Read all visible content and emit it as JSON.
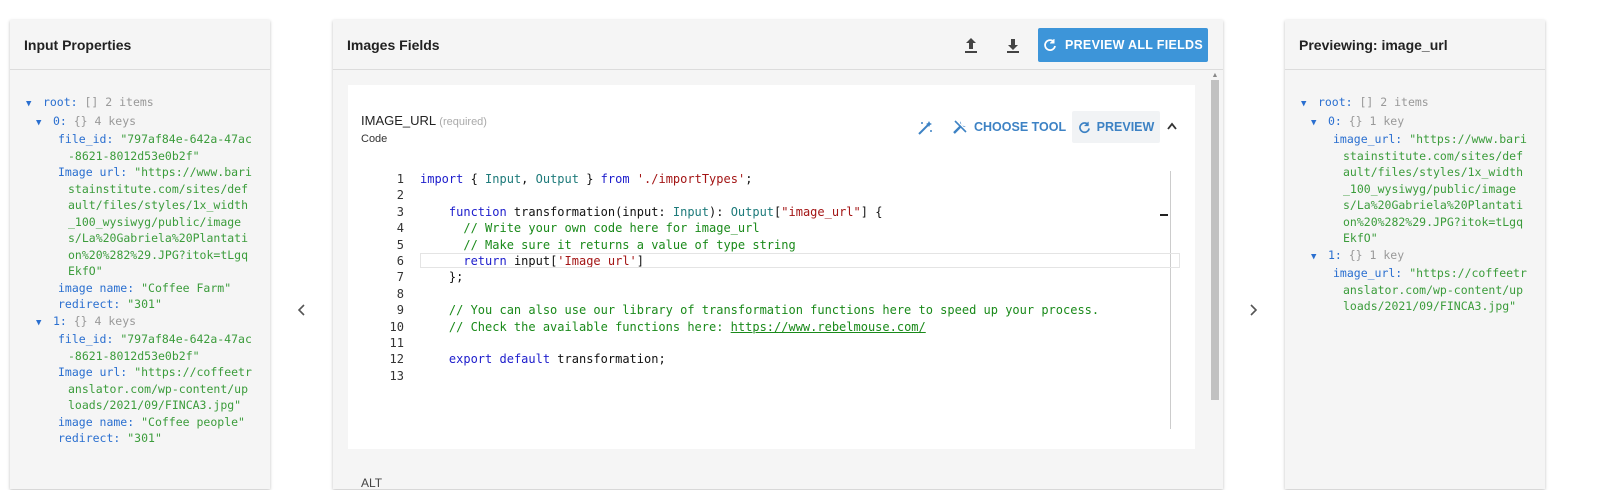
{
  "left_panel": {
    "title": "Input Properties",
    "tree": {
      "root_key": "root:",
      "root_meta": "[] 2 items",
      "items": [
        {
          "key": "0:",
          "meta": "{} 4 keys",
          "fields": [
            {
              "key": "file_id:",
              "value": "\"797af84e-642a-47ac-8621-8012d53e0b2f\""
            },
            {
              "key": "Image url:",
              "value": "\"https://www.baristainstitute.com/sites/default/files/styles/1x_width_100_wysiwyg/public/images/La%20Gabriela%20Plantation%20%282%29.JPG?itok=tLgqEkfO\""
            },
            {
              "key": "image name:",
              "value": "\"Coffee Farm\""
            },
            {
              "key": "redirect:",
              "value": "\"301\""
            }
          ]
        },
        {
          "key": "1:",
          "meta": "{} 4 keys",
          "fields": [
            {
              "key": "file_id:",
              "value": "\"797af84e-642a-47ac-8621-8012d53e0b2f\""
            },
            {
              "key": "Image url:",
              "value": "\"https://coffeetranslator.com/wp-content/uploads/2021/09/FINCA3.jpg\""
            },
            {
              "key": "image name:",
              "value": "\"Coffee people\""
            },
            {
              "key": "redirect:",
              "value": "\"301\""
            }
          ]
        }
      ]
    }
  },
  "center_panel": {
    "title": "Images Fields",
    "preview_all_label": "PREVIEW ALL FIELDS",
    "field": {
      "name": "IMAGE_URL",
      "required_label": "(required)",
      "type": "Code",
      "choose_tool_label": "CHOOSE TOOL",
      "preview_label": "PREVIEW",
      "code_lines": [
        "1",
        "2",
        "3",
        "4",
        "5",
        "6",
        "7",
        "8",
        "9",
        "10",
        "11",
        "12",
        "13"
      ]
    },
    "next_field_label": "ALT"
  },
  "right_panel": {
    "title": "Previewing: image_url",
    "tree": {
      "root_key": "root:",
      "root_meta": "[] 2 items",
      "items": [
        {
          "key": "0:",
          "meta": "{} 1 key",
          "field_key": "image_url:",
          "field_value": "\"https://www.baristainstitute.com/sites/default/files/styles/1x_width_100_wysiwyg/public/images/La%20Gabriela%20Plantation%20%282%29.JPG?itok=tLgqEkfO\""
        },
        {
          "key": "1:",
          "meta": "{} 1 key",
          "field_key": "image_url:",
          "field_value": "\"https://coffeetranslator.com/wp-content/uploads/2021/09/FINCA3.jpg\""
        }
      ]
    }
  },
  "code": {
    "l1": {
      "a": "import",
      "b": " { ",
      "c": "Input",
      "d": ", ",
      "e": "Output",
      "f": " } ",
      "g": "from",
      "h": " ",
      "i": "'./importTypes'",
      "j": ";"
    },
    "l3": {
      "a": "function",
      "b": " transformation(input: ",
      "c": "Input",
      "d": "): ",
      "e": "Output",
      "f": "[",
      "g": "\"image_url\"",
      "h": "] {"
    },
    "l4": "// Write your own code here for image_url",
    "l5": "// Make sure it returns a value of type string",
    "l6": {
      "a": "return",
      "b": " input[",
      "c": "'Image url'",
      "d": "]"
    },
    "l7": "};",
    "l9": "// You can also use our library of transformation functions here to speed up your process.",
    "l10": {
      "a": "// Check the available functions here: ",
      "b": "https://www.rebelmouse.com/"
    },
    "l12": {
      "a": "export",
      "b": " ",
      "c": "default",
      "d": " transformation;"
    }
  },
  "icons": {
    "upload": "upload-icon",
    "download": "download-icon",
    "refresh": "refresh-icon",
    "magic": "magic-wand-icon",
    "tools": "tools-icon",
    "chevron_up": "chevron-up-icon",
    "chevron_left": "chevron-left-icon",
    "chevron_right": "chevron-right-icon"
  },
  "colors": {
    "accent": "#3d95d9",
    "link": "#3d82c4",
    "tree_key": "#2a6fd0",
    "tree_string": "#3b9c3b"
  }
}
